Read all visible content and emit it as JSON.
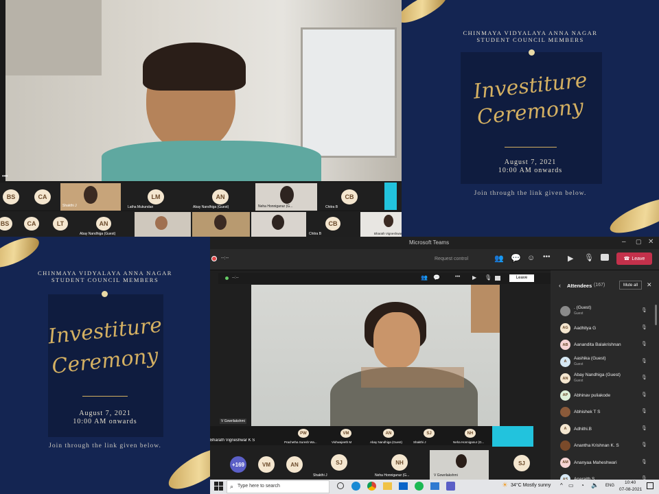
{
  "poster": {
    "org_line1": "CHINMAYA VIDYALAYA ANNA NAGAR",
    "org_line2": "STUDENT COUNCIL MEMBERS",
    "title_line1": "Investiture",
    "title_line2": "Ceremony",
    "date": "August 7, 2021",
    "time": "10:00 AM onwards",
    "join": "Join through the link given below."
  },
  "topleft": {
    "row1": [
      {
        "initials": "BS"
      },
      {
        "initials": "CA"
      },
      {
        "name": "Shakthi J"
      },
      {
        "initials": "LM",
        "name": "Latha Mukundan"
      },
      {
        "initials": "AN",
        "name": "Abay Nandhiga (Guest)"
      },
      {
        "name": "Neha Honniganur (G..."
      },
      {
        "initials": "CB",
        "name": "Chitra B"
      }
    ],
    "row2": [
      {
        "initials": "BS"
      },
      {
        "initials": "CA"
      },
      {
        "initials": "LT"
      },
      {
        "initials": "AN",
        "name": "Abay Nandhiga (Guest)"
      },
      {
        "initials": "CB",
        "name": "Chitra B"
      },
      {
        "name": "Bharath Vigneshwar..."
      }
    ]
  },
  "teams": {
    "window_title": "Microsoft Teams",
    "timer": "--:--",
    "request_control": "Request control",
    "leave_label": "Leave",
    "inner_leave": "Leave",
    "inner_timer": "--:--",
    "speaker_label": "V Gowrilakshmi",
    "strip": [
      {
        "name": "Bharath Vigneshwar K S"
      },
      {
        "initials": "PW",
        "name": "Prachetha Suresh Wa..."
      },
      {
        "initials": "VM",
        "name": "Vishwajeeth M"
      },
      {
        "initials": "AN",
        "name": "Abay Nandhiga (Guest)"
      },
      {
        "initials": "SJ",
        "name": "Shakthi J"
      },
      {
        "initials": "NH",
        "name": "Neha Honniganur (G..."
      }
    ],
    "bottom_row": [
      {
        "initials": "+169"
      },
      {
        "initials": "VM"
      },
      {
        "initials": "AN"
      },
      {
        "initials": "SJ",
        "name": "Shakthi J"
      },
      {
        "initials": "NH",
        "name": "Neha Honniganur (G..."
      },
      {
        "name": "V Gowrilakshmi"
      },
      {
        "initials": "SJ"
      }
    ],
    "attendees": {
      "title": "Attendees",
      "count": "(167)",
      "mute_all": "Mute all",
      "people": [
        {
          "initials": "",
          "name": ". (Guest)",
          "sub": "Guest",
          "color": "#8a8a8a"
        },
        {
          "initials": "AG",
          "name": "Aadhitya G",
          "sub": "",
          "color": "#f4e6cf"
        },
        {
          "initials": "AB",
          "name": "Aanandita Balakrishnan",
          "sub": "",
          "color": "#f6d4d4"
        },
        {
          "initials": "A",
          "name": "Aashika (Guest)",
          "sub": "Guest",
          "color": "#d6e8f4"
        },
        {
          "initials": "AN",
          "name": "Abay Nandhiga (Guest)",
          "sub": "Guest",
          "color": "#f4e6cf"
        },
        {
          "initials": "AP",
          "name": "Abhinav puliakode",
          "sub": "",
          "color": "#dcefd9"
        },
        {
          "initials": "",
          "name": "Abhishek T S",
          "sub": "",
          "color": "#8a5a3a"
        },
        {
          "initials": "A",
          "name": "Adhithi.B",
          "sub": "",
          "color": "#f4e6cf"
        },
        {
          "initials": "",
          "name": "Anantha Krishnan K. S",
          "sub": "",
          "color": "#7a4a2a"
        },
        {
          "initials": "AM",
          "name": "Ananyaa Maheshwari",
          "sub": "",
          "color": "#f6d4d4"
        },
        {
          "initials": "AS",
          "name": "Anaraith S",
          "sub": "",
          "color": "#d6e8f4"
        }
      ]
    }
  },
  "taskbar": {
    "search_placeholder": "Type here to search",
    "weather": "34°C  Mostly sunny",
    "lang": "ENG",
    "time": "10:40",
    "date": "07-08-2021"
  }
}
